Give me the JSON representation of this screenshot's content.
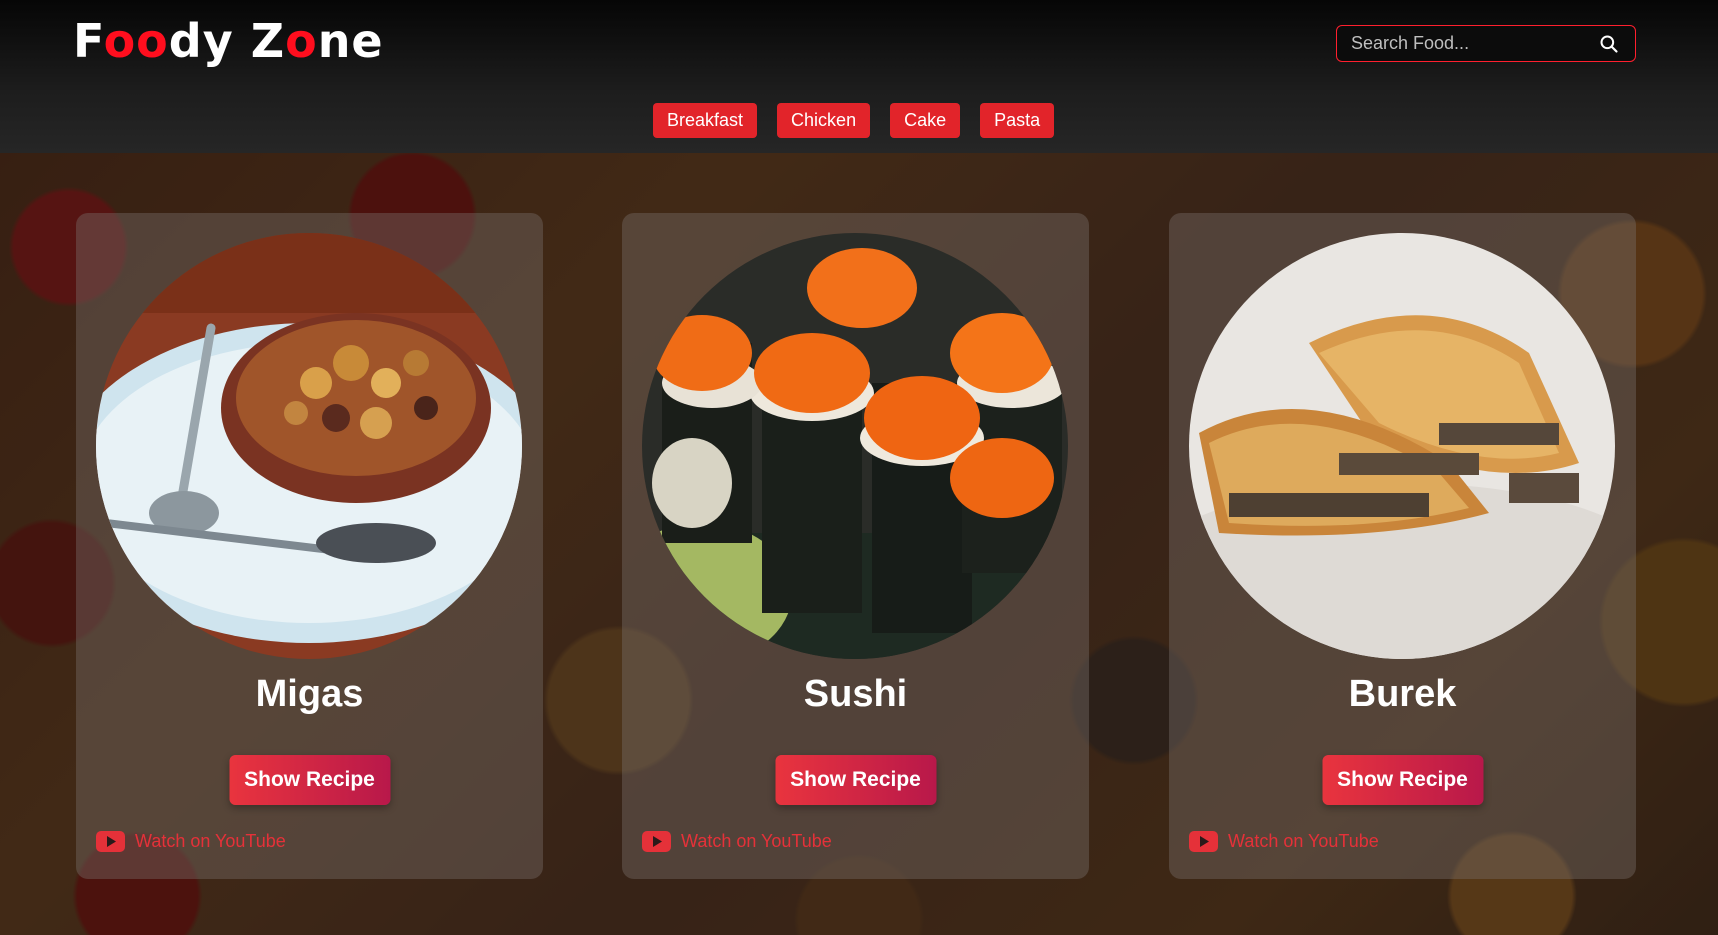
{
  "brand": {
    "title_parts": [
      "F",
      "oo",
      "dy Z",
      "o",
      "ne"
    ]
  },
  "search": {
    "placeholder": "Search Food..."
  },
  "filters": [
    "Breakfast",
    "Chicken",
    "Cake",
    "Pasta"
  ],
  "cards": [
    {
      "name": "Migas",
      "button": "Show Recipe",
      "youtube": "Watch on YouTube"
    },
    {
      "name": "Sushi",
      "button": "Show Recipe",
      "youtube": "Watch on YouTube"
    },
    {
      "name": "Burek",
      "button": "Show Recipe",
      "youtube": "Watch on YouTube"
    }
  ],
  "colors": {
    "accent": "#e2242a",
    "logo_red": "#ff0e1e",
    "youtube_red": "#e53139"
  }
}
